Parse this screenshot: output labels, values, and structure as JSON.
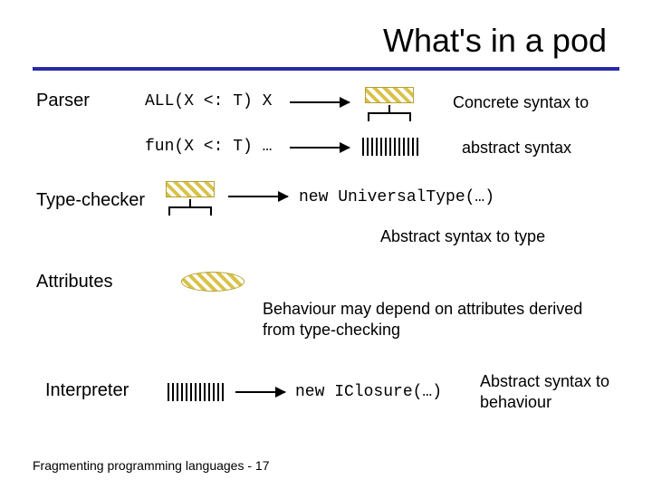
{
  "title": "What's in a pod",
  "labels": {
    "parser": "Parser",
    "typechecker": "Type-checker",
    "attributes": "Attributes",
    "interpreter": "Interpreter"
  },
  "code": {
    "parser_in": "ALL(X <: T) X",
    "parser_mid": "fun(X <: T) …",
    "typechecker_out": "new UniversalType(…)",
    "interpreter_out": "new IClosure(…)"
  },
  "desc": {
    "concrete": "Concrete syntax to",
    "abstract": "abstract syntax",
    "ast_to_type": "Abstract syntax to type",
    "behaviour": "Behaviour may depend on attributes derived from type-checking",
    "ast_to_behaviour": "Abstract syntax to behaviour"
  },
  "footer": "Fragmenting programming languages  - 17"
}
